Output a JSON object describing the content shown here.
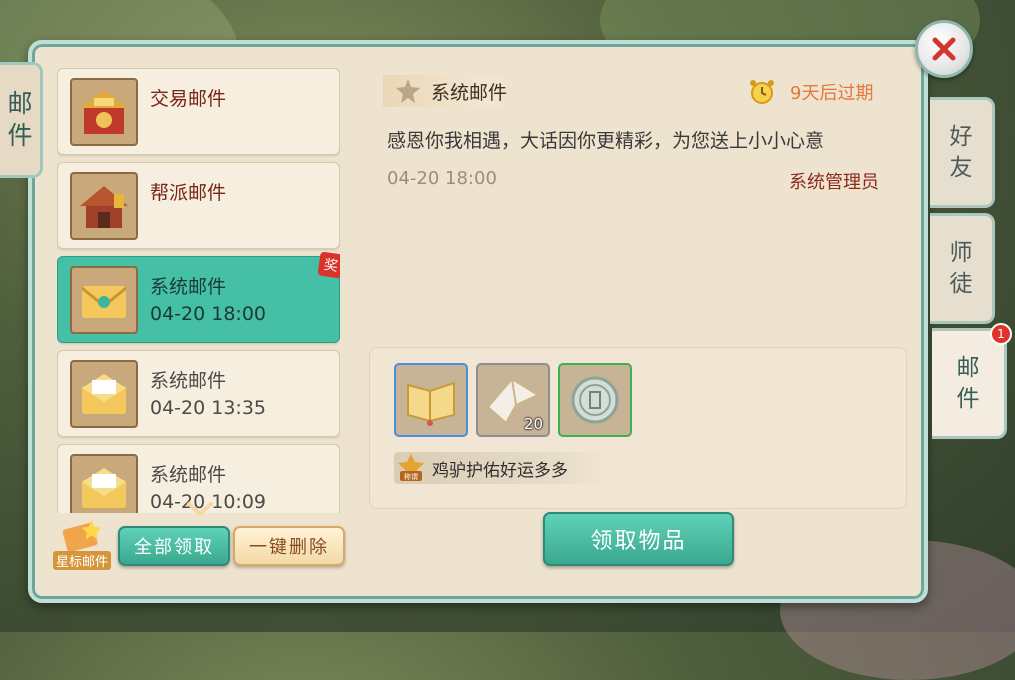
{
  "panel": {
    "side_title": [
      "邮",
      "件"
    ]
  },
  "close": {
    "icon": "close-icon"
  },
  "tabs": [
    {
      "label": [
        "好",
        "友"
      ],
      "active": false,
      "badge": ""
    },
    {
      "label": [
        "师",
        "徒"
      ],
      "active": false,
      "badge": ""
    },
    {
      "label": [
        "邮",
        "件"
      ],
      "active": true,
      "badge": "1"
    }
  ],
  "mail_list": [
    {
      "title": "交易邮件",
      "date": "",
      "icon": "trade-shop-icon",
      "selected": false,
      "read": false,
      "reward": ""
    },
    {
      "title": "帮派邮件",
      "date": "",
      "icon": "guild-house-icon",
      "selected": false,
      "read": false,
      "reward": ""
    },
    {
      "title": "系统邮件",
      "date": "04-20 18:00",
      "icon": "envelope-icon",
      "selected": true,
      "read": false,
      "reward": "奖"
    },
    {
      "title": "系统邮件",
      "date": "04-20 13:35",
      "icon": "open-envelope-icon",
      "selected": false,
      "read": true,
      "reward": ""
    },
    {
      "title": "系统邮件",
      "date": "04-20 10:09",
      "icon": "open-envelope-icon",
      "selected": false,
      "read": true,
      "reward": ""
    }
  ],
  "bottom_bar": {
    "star_mail_label": "星标邮件",
    "claim_all_label": "全部领取",
    "delete_all_label": "一键删除"
  },
  "detail": {
    "header_title": "系统邮件",
    "expire_text": "9天后过期",
    "body": "感恩你我相遇，大话因你更精彩，为您送上小小心意",
    "date": "04-20 18:00",
    "sender": "系统管理员",
    "attachments": [
      {
        "icon": "book-scroll-icon",
        "count": "",
        "border": "#4a90d9"
      },
      {
        "icon": "paper-crane-icon",
        "count": "20",
        "border": "#8f8f8f"
      },
      {
        "icon": "silver-coin-icon",
        "count": "",
        "border": "#3fae55"
      }
    ],
    "title_reward_badge": "称谓",
    "title_reward": "鸡驴护佑好运多多",
    "claim_label": "领取物品"
  },
  "colors": {
    "accent": "#45c0a6",
    "expire": "#e07a3a",
    "sender": "#8a2b1e"
  }
}
